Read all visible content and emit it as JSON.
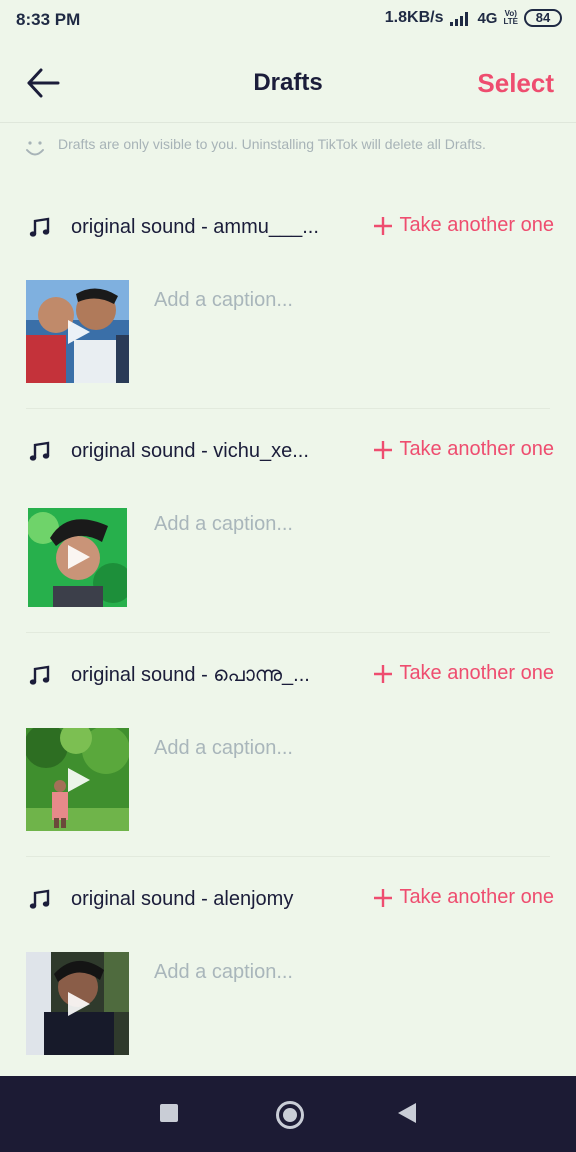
{
  "status_bar": {
    "time": "8:33 PM",
    "net_speed": "1.8KB/s",
    "net_type": "4G",
    "volte_top": "Vo)",
    "volte_bottom": "LTE",
    "battery": "84"
  },
  "header": {
    "title": "Drafts",
    "select_label": "Select",
    "back_icon": "arrow-left-icon"
  },
  "notice": {
    "text": "Drafts are only visible to you. Uninstalling TikTok will delete all Drafts.",
    "icon": "smile-icon"
  },
  "drafts": [
    {
      "sound": "original sound - ammu___...",
      "take_another": "Take another one",
      "caption_placeholder": "Add a caption..."
    },
    {
      "sound": "original sound - vichu_xe...",
      "take_another": "Take another one",
      "caption_placeholder": "Add a caption..."
    },
    {
      "sound": "original sound - പൊന്നു_...",
      "take_another": "Take another one",
      "caption_placeholder": "Add a caption..."
    },
    {
      "sound": "original sound - alenjomy",
      "take_another": "Take another one",
      "caption_placeholder": "Add a caption..."
    }
  ],
  "colors": {
    "background": "#eef6ea",
    "accent": "#ee4d6f",
    "text": "#1b1d3a",
    "nav_bar": "#1c1b34"
  }
}
